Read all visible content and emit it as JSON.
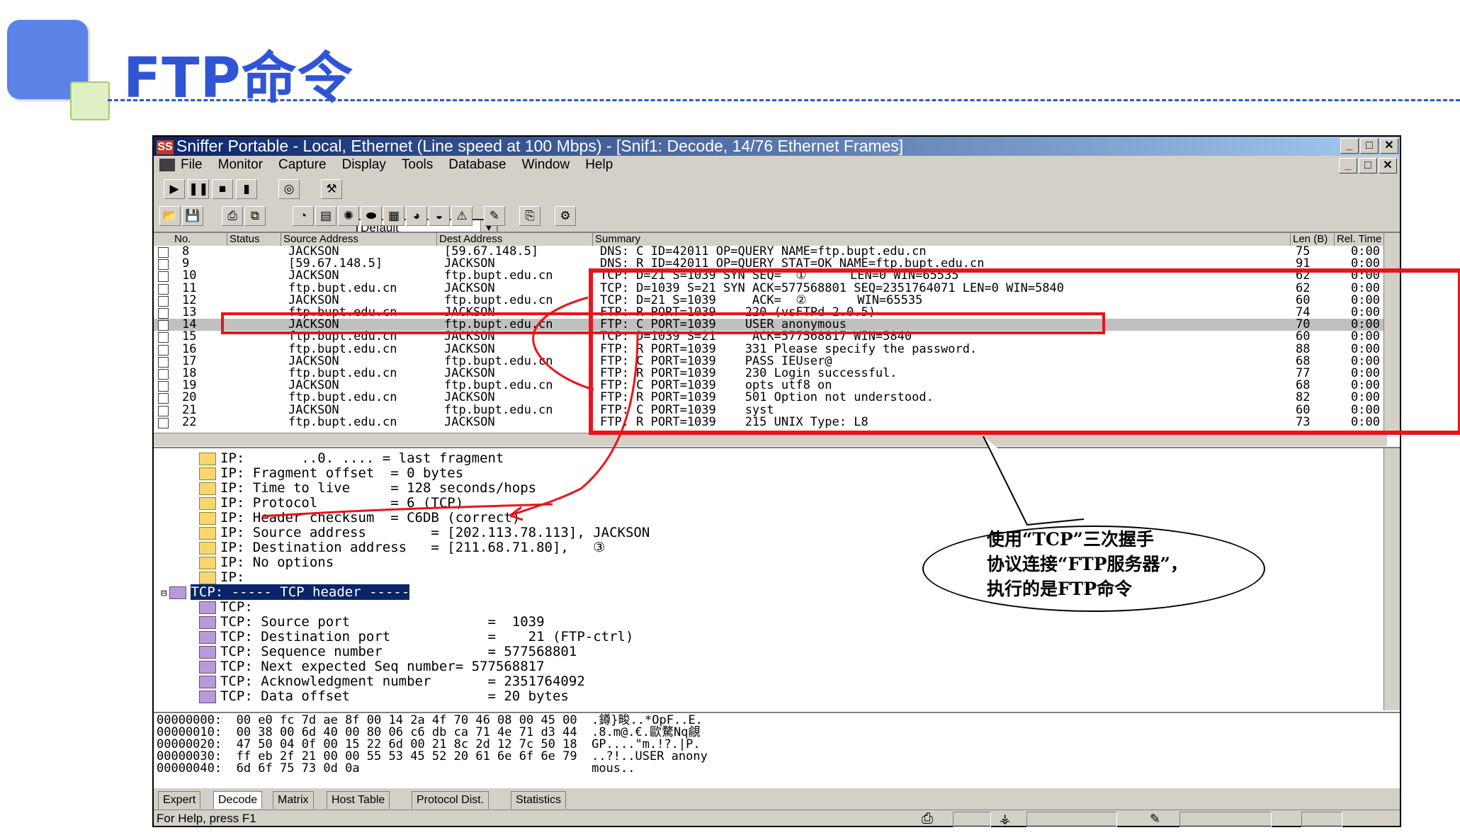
{
  "slide": {
    "title": "FTP命令"
  },
  "window": {
    "title": "Sniffer Portable - Local, Ethernet (Line speed at 100 Mbps) - [Snif1: Decode, 14/76 Ethernet Frames]",
    "app_icon": "SS",
    "controls": [
      "_",
      "□",
      "✕"
    ],
    "mdi_controls": [
      "_",
      "□",
      "✕"
    ]
  },
  "menu": {
    "items": [
      "File",
      "Monitor",
      "Capture",
      "Display",
      "Tools",
      "Database",
      "Window",
      "Help"
    ]
  },
  "toolbar": {
    "profile_select": "Default"
  },
  "packets": {
    "columns": [
      "No.",
      "Status",
      "Source Address",
      "Dest Address",
      "Summary",
      "Len (B)",
      "Rel. Time"
    ],
    "rows": [
      {
        "no": "8",
        "src": "JACKSON",
        "dst": "[59.67.148.5]",
        "summary": "DNS: C ID=42011 OP=QUERY NAME=ftp.bupt.edu.cn",
        "len": "75",
        "time": "0:00"
      },
      {
        "no": "9",
        "src": "[59.67.148.5]",
        "dst": "JACKSON",
        "summary": "DNS: R ID=42011 OP=QUERY STAT=OK NAME=ftp.bupt.edu.cn",
        "len": "91",
        "time": "0:00"
      },
      {
        "no": "10",
        "src": "JACKSON",
        "dst": "ftp.bupt.edu.cn",
        "summary": "TCP: D=21 S=1039 SYN SEQ=  ①      LEN=0 WIN=65535",
        "len": "62",
        "time": "0:00"
      },
      {
        "no": "11",
        "src": "ftp.bupt.edu.cn",
        "dst": "JACKSON",
        "summary": "TCP: D=1039 S=21 SYN ACK=577568801 SEQ=2351764071 LEN=0 WIN=5840",
        "len": "62",
        "time": "0:00"
      },
      {
        "no": "12",
        "src": "JACKSON",
        "dst": "ftp.bupt.edu.cn",
        "summary": "TCP: D=21 S=1039     ACK=  ②       WIN=65535",
        "len": "60",
        "time": "0:00"
      },
      {
        "no": "13",
        "src": "ftp.bupt.edu.cn",
        "dst": "JACKSON",
        "summary": "FTP: R PORT=1039    220 (vsFTPd 2.0.5)",
        "len": "74",
        "time": "0:00"
      },
      {
        "no": "14",
        "src": "JACKSON",
        "dst": "ftp.bupt.edu.cn",
        "summary": "FTP: C PORT=1039    USER anonymous",
        "len": "70",
        "time": "0:00"
      },
      {
        "no": "15",
        "src": "ftp.bupt.edu.cn",
        "dst": "JACKSON",
        "summary": "TCP: D=1039 S=21     ACK=577568817 WIN=5840",
        "len": "60",
        "time": "0:00"
      },
      {
        "no": "16",
        "src": "ftp.bupt.edu.cn",
        "dst": "JACKSON",
        "summary": "FTP: R PORT=1039    331 Please specify the password.",
        "len": "88",
        "time": "0:00"
      },
      {
        "no": "17",
        "src": "JACKSON",
        "dst": "ftp.bupt.edu.cn",
        "summary": "FTP: C PORT=1039    PASS IEUser@",
        "len": "68",
        "time": "0:00"
      },
      {
        "no": "18",
        "src": "ftp.bupt.edu.cn",
        "dst": "JACKSON",
        "summary": "FTP: R PORT=1039    230 Login successful.",
        "len": "77",
        "time": "0:00"
      },
      {
        "no": "19",
        "src": "JACKSON",
        "dst": "ftp.bupt.edu.cn",
        "summary": "FTP: C PORT=1039    opts utf8 on",
        "len": "68",
        "time": "0:00"
      },
      {
        "no": "20",
        "src": "ftp.bupt.edu.cn",
        "dst": "JACKSON",
        "summary": "FTP: R PORT=1039    501 Option not understood.",
        "len": "82",
        "time": "0:00"
      },
      {
        "no": "21",
        "src": "JACKSON",
        "dst": "ftp.bupt.edu.cn",
        "summary": "FTP: C PORT=1039    syst",
        "len": "60",
        "time": "0:00"
      },
      {
        "no": "22",
        "src": "ftp.bupt.edu.cn",
        "dst": "JACKSON",
        "summary": "FTP: R PORT=1039    215 UNIX Type: L8",
        "len": "73",
        "time": "0:00"
      }
    ]
  },
  "decode": {
    "lines": [
      "IP:       ..0. .... = last fragment",
      "IP: Fragment offset  = 0 bytes",
      "IP: Time to live     = 128 seconds/hops",
      "IP: Protocol         = 6 (TCP)",
      "IP: Header checksum  = C6DB (correct)",
      "IP: Source address        = [202.113.78.113], JACKSON",
      "IP: Destination address   = [211.68.71.80],   ③",
      "IP: No options",
      "IP:",
      "TCP: ----- TCP header -----",
      "TCP:",
      "TCP: Source port                 =  1039",
      "TCP: Destination port            =    21 (FTP-ctrl)",
      "TCP: Sequence number             = 577568801",
      "TCP: Next expected Seq number= 577568817",
      "TCP: Acknowledgment number       = 2351764092",
      "TCP: Data offset                 = 20 bytes"
    ]
  },
  "hex": {
    "lines": [
      "00000000:  00 e0 fc 7d ae 8f 00 14 2a 4f 70 46 08 00 45 00  .鐏}畯..*OpF..E.",
      "00000010:  00 38 00 6d 40 00 80 06 c6 db ca 71 4e 71 d3 44  .8.m@.€.歐騖Nq覦",
      "00000020:  47 50 04 0f 00 15 22 6d 00 21 8c 2d 12 7c 50 18  GP....\"m.!?.|P.",
      "00000030:  ff eb 2f 21 00 00 55 53 45 52 20 61 6e 6f 6e 79  ..?!..USER anony",
      "00000040:  6d 6f 75 73 0d 0a                                mous.."
    ]
  },
  "tabs": [
    "Expert",
    "Decode",
    "Matrix",
    "Host Table",
    "Protocol Dist.",
    "Statistics"
  ],
  "status": {
    "text": "For Help, press F1"
  },
  "callout": {
    "line1": "使用“TCP”三次握手",
    "line2": "协议连接“FTP服务器”，",
    "line3": "执行的是FTP命令"
  },
  "colors": {
    "slide_accent": "#2f55d4",
    "annotation_red": "#e8151b",
    "selection_highlight": "#0a246a"
  }
}
